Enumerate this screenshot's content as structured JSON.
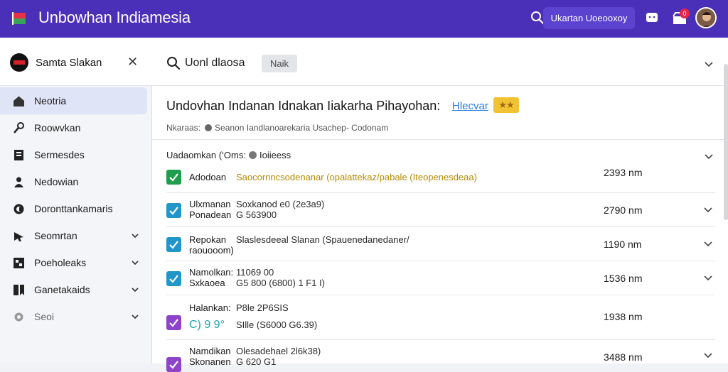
{
  "app": {
    "title": "Unbowhan Indiamesia",
    "search_button": "Ukartan Uoeooxoy",
    "notif_badge": "0"
  },
  "sidebar": {
    "header_title": "Samta Slakan",
    "items": [
      {
        "label": "Neotria",
        "icon": "home-icon",
        "active": true
      },
      {
        "label": "Roowvkan",
        "icon": "wrench-icon"
      },
      {
        "label": "Sermesdes",
        "icon": "book-icon"
      },
      {
        "label": "Nedowian",
        "icon": "person-icon"
      },
      {
        "label": "Doronttankamaris",
        "icon": "circle-c-icon"
      },
      {
        "label": "Seomrtan",
        "icon": "arrow-icon",
        "expandable": true
      },
      {
        "label": "Poeholeaks",
        "icon": "grid-icon",
        "expandable": true
      },
      {
        "label": "Ganetakaids",
        "icon": "bookmark-icon",
        "expandable": true
      },
      {
        "label": "Seoi",
        "icon": "settings-icon",
        "expandable": true
      }
    ]
  },
  "search": {
    "value": "Uonl dlaosa",
    "tag": "Naik"
  },
  "page": {
    "title": "Undovhan Indanan Idnakan Iiakarha Pihayohan:",
    "link": "Hlecvar",
    "stars": "★★",
    "meta_label": "Nkaraas:",
    "meta_text": "Seanon Iandlanoarekaria Usachep­- Codonam"
  },
  "list": {
    "header_label": "Uadaomkan (‘Oms:",
    "header_value": "Ioiieess",
    "rows": [
      {
        "name": "Adodoan",
        "desc": "Saocornncsodenanar (opalattekaz/pabale (Iteopenesdeaa)",
        "value": "2393 nm",
        "check_color": "#1f9d4e",
        "desc_color": "#b58a00"
      },
      {
        "name": "Ulxmanan\nPonadean",
        "desc": "Soxkanod e0 (2e3a9)\nG 563900",
        "value": "2790 nm",
        "check_color": "#2196c9"
      },
      {
        "name": "Repokan\nraouooom)",
        "desc": "Slaslesdeeal Slanan (Spauenedanedaner/",
        "value": "1190 nm",
        "check_color": "#2196c9"
      },
      {
        "name": "Namolkan:\nSxkaoea",
        "desc": "11069 00\nG5 800 (6800) 1 F1 I)",
        "value": "1536 nm",
        "check_color": "#2196c9"
      },
      {
        "name": "Halankan:",
        "desc": "P8le  2P6SIS",
        "name2": "C) 9 9°",
        "desc2": "SIlle  (S6000 G6.39)",
        "value": "1938 nm",
        "check_color": "#8e44c9"
      },
      {
        "name": "Namdikan\nSkonanen",
        "desc": "Olesadehael 2l6k38)\nG 620 G1",
        "value": "3488 nm",
        "check_color": "#8e44c9"
      }
    ]
  }
}
